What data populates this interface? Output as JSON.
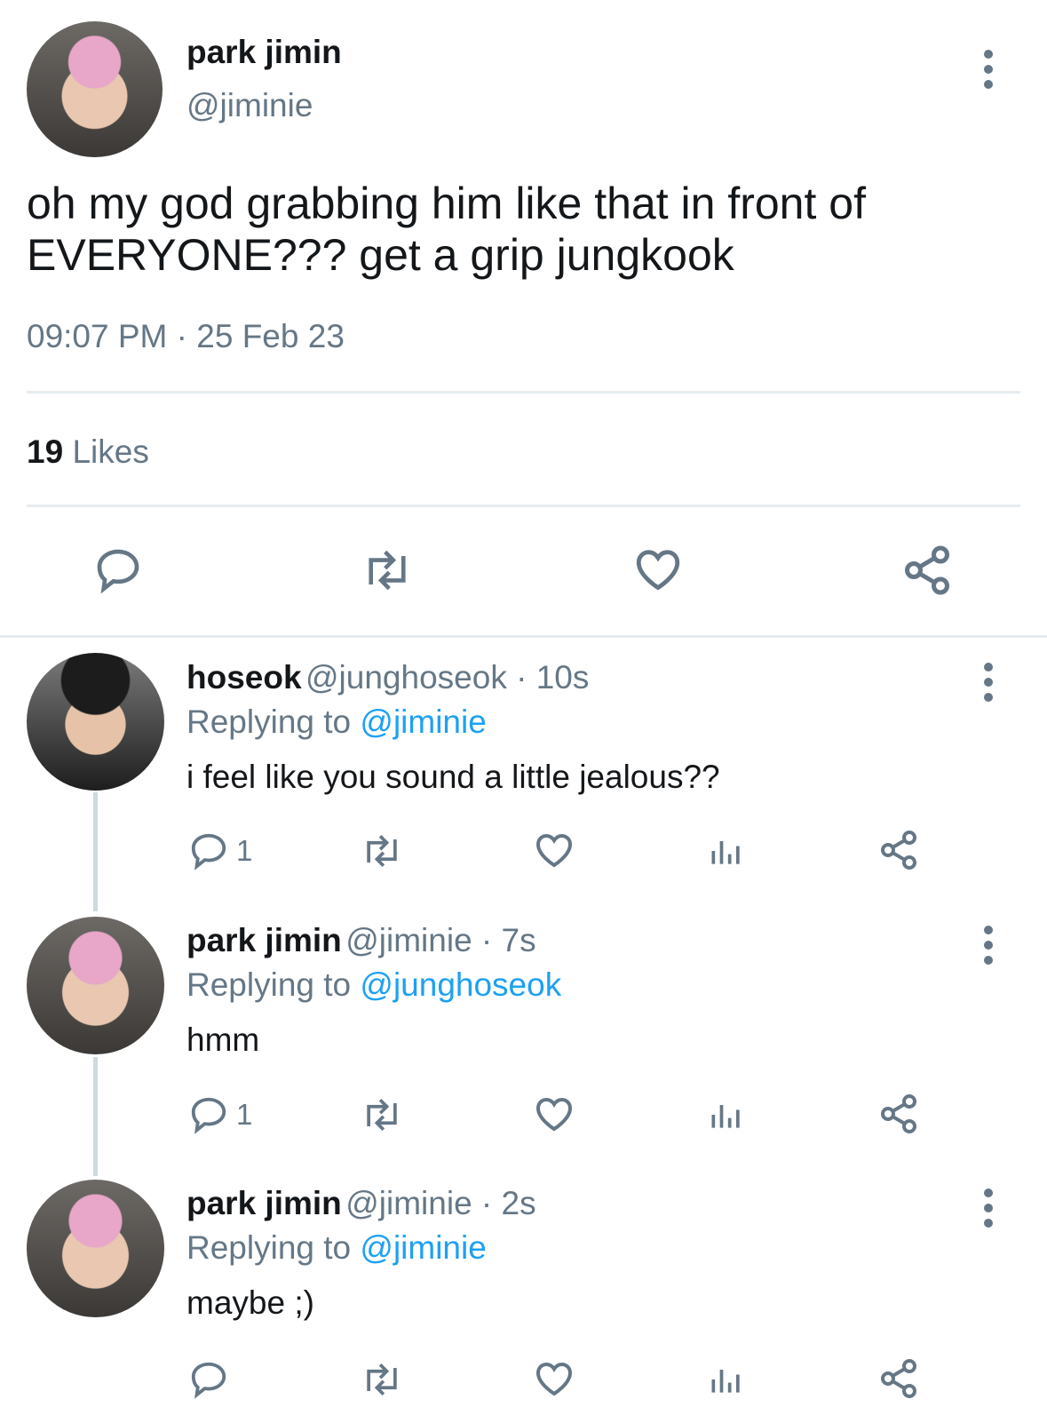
{
  "main_tweet": {
    "display_name": "park jimin",
    "handle": "@jiminie",
    "text_line1": "oh my god grabbing him like that in front of",
    "text_line2": "EVERYONE??? get a grip jungkook",
    "time": "09:07 PM",
    "separator": "·",
    "date": "25 Feb 23",
    "likes_count": "19",
    "likes_label": "Likes"
  },
  "replies": [
    {
      "display_name": "hoseok",
      "handle_time": "@junghoseok · 10s",
      "replying_prefix": "Replying to",
      "replying_to": "@jiminie",
      "text": "i feel like you sound a little jealous??",
      "reply_count": "1"
    },
    {
      "display_name": "park jimin",
      "handle_time": "@jiminie · 7s",
      "replying_prefix": "Replying to",
      "replying_to": "@junghoseok",
      "text": "hmm",
      "reply_count": "1"
    },
    {
      "display_name": "park jimin",
      "handle_time": "@jiminie · 2s",
      "replying_prefix": "Replying to",
      "replying_to": "@jiminie",
      "text": "maybe ;)",
      "reply_count": ""
    }
  ],
  "colors": {
    "text": "#14171a",
    "muted": "#657786",
    "link": "#1da1f2",
    "divider": "#e6ecf0"
  },
  "icons": [
    "more-icon",
    "reply-icon",
    "retweet-icon",
    "like-icon",
    "share-icon",
    "analytics-icon"
  ]
}
